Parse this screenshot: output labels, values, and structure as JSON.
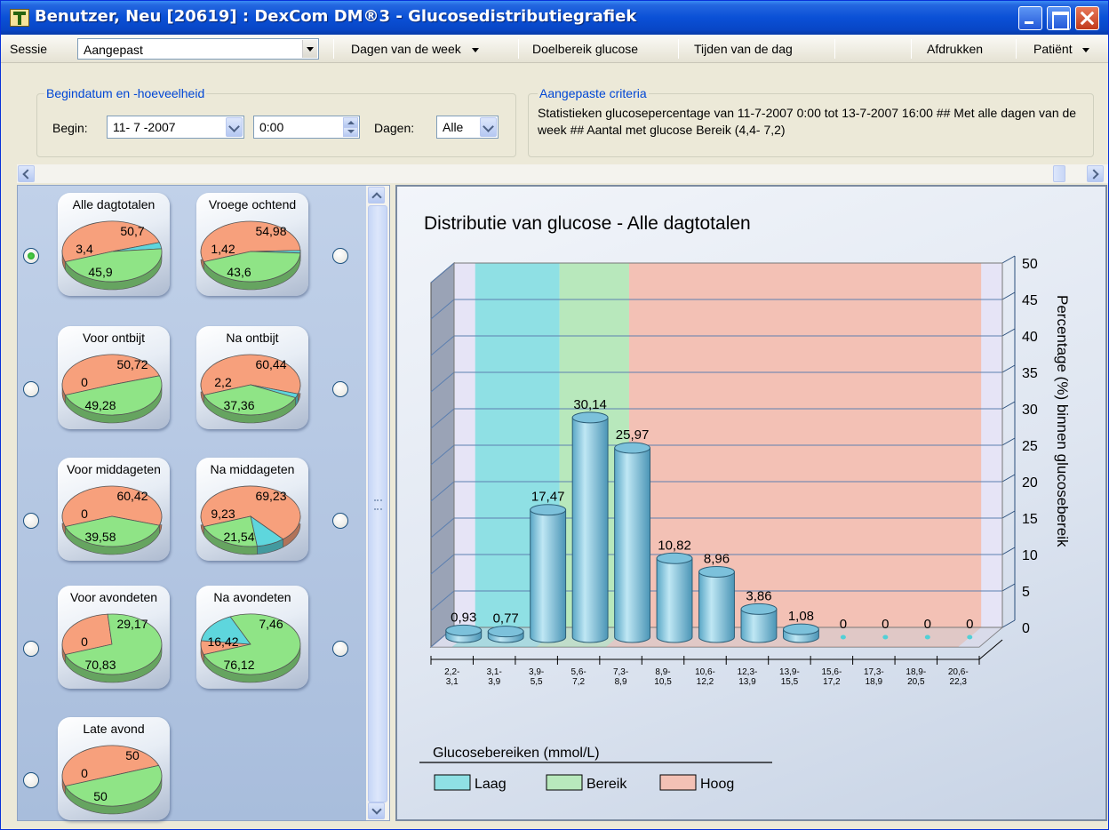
{
  "window": {
    "title": "Benutzer, Neu [20619] : DexCom DM®3 - Glucosedistributiegrafiek"
  },
  "toolbar": {
    "session_label": "Sessie",
    "session_value": "Aangepast",
    "weekdays": "Dagen van de week",
    "target_range": "Doelbereik glucose",
    "times_of_day": "Tijden van de dag",
    "print": "Afdrukken",
    "patient": "Patiënt"
  },
  "start_group": {
    "title": "Begindatum en -hoeveelheid",
    "begin_label": "Begin:",
    "begin_date": "11- 7 -2007",
    "begin_time": "0:00",
    "days_label": "Dagen:",
    "days_value": "Alle"
  },
  "criteria_group": {
    "title": "Aangepaste criteria",
    "text": "Statistieken glucosepercentage van 11-7-2007 0:00 tot 13-7-2007 16:00 ## Met alle dagen van de week ## Aantal met glucose Bereik (4,4- 7,2)"
  },
  "colors": {
    "laag": "#8fe0e4",
    "bereik": "#b8e8bc",
    "hoog": "#f3c1b5",
    "pie_high": "#f7a07c",
    "pie_range": "#8fe486",
    "pie_low": "#5ed6dd",
    "bar": "#8fd0e6"
  },
  "pies": [
    {
      "title": "Alle dagtotalen",
      "high": "50,7",
      "range": "45,9",
      "low": "3,4",
      "selected": true
    },
    {
      "title": "Vroege ochtend",
      "high": "54,98",
      "range": "43,6",
      "low": "1,42",
      "selected": false
    },
    {
      "title": "Voor ontbijt",
      "high": "50,72",
      "range": "49,28",
      "low": "0",
      "selected": false
    },
    {
      "title": "Na ontbijt",
      "high": "60,44",
      "range": "37,36",
      "low": "2,2",
      "selected": false
    },
    {
      "title": "Voor middageten",
      "high": "60,42",
      "range": "39,58",
      "low": "0",
      "selected": false
    },
    {
      "title": "Na middageten",
      "high": "69,23",
      "range": "21,54",
      "low": "9,23",
      "selected": false
    },
    {
      "title": "Voor avondeten",
      "high": "29,17",
      "range": "70,83",
      "low": "0",
      "selected": false
    },
    {
      "title": "Na avondeten",
      "high": "7,46",
      "range": "76,12",
      "low": "16,42",
      "selected": false
    },
    {
      "title": "Late avond",
      "high": "50",
      "range": "50",
      "low": "0",
      "selected": false
    }
  ],
  "chart_data": {
    "type": "bar",
    "title": "Distributie van glucose - Alle dagtotalen",
    "ylabel": "Percentage (%) binnen glucosebereik",
    "ylim": [
      0,
      50
    ],
    "yticks": [
      "0",
      "5",
      "10",
      "15",
      "20",
      "25",
      "30",
      "35",
      "40",
      "45",
      "50"
    ],
    "categories": [
      "2,2-|3,1",
      "3,1-|3,9",
      "3,9-|5,5",
      "5,6-|7,2",
      "7,3-|8,9",
      "8,9-|10,5",
      "10,6-|12,2",
      "12,3-|13,9",
      "13,9-|15,5",
      "15,6-|17,2",
      "17,3-|18,9",
      "18,9-|20,5",
      "20,6-|22,3"
    ],
    "values": [
      0.93,
      0.77,
      17.47,
      30.14,
      25.97,
      10.82,
      8.96,
      3.86,
      1.08,
      0,
      0,
      0,
      0
    ],
    "value_labels": [
      "0,93",
      "0,77",
      "17,47",
      "30,14",
      "25,97",
      "10,82",
      "8,96",
      "3,86",
      "1,08",
      "0",
      "0",
      "0",
      "0"
    ],
    "legend": {
      "title": "Glucosebereiken (mmol/L)",
      "items": [
        "Laag",
        "Bereik",
        "Hoog"
      ]
    }
  }
}
